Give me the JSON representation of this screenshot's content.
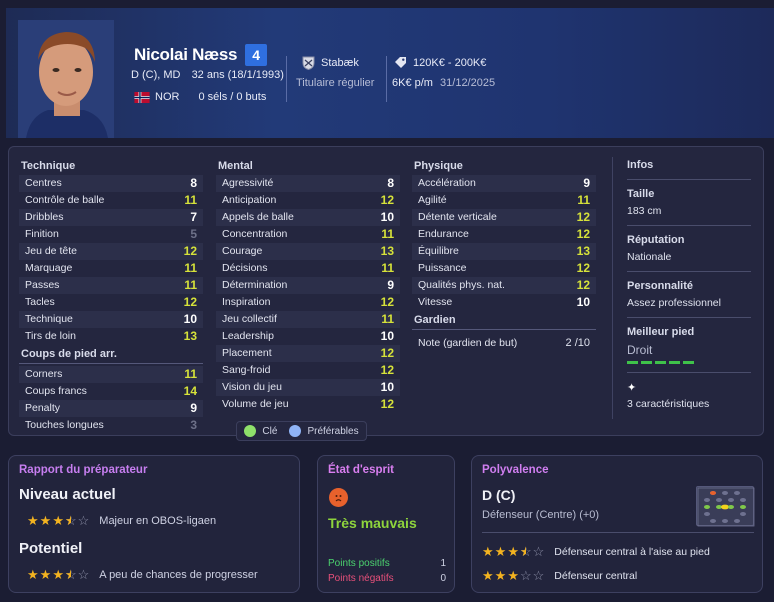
{
  "player": {
    "name": "Nicolai Næss",
    "number": "4",
    "positions": "D (C), MD",
    "age": "32 ans (18/1/1993)",
    "nationality": "NOR",
    "caps": "0 séls / 0 buts",
    "club": "Stabæk",
    "role": "Titulaire régulier",
    "value": "120K€ - 200K€",
    "wage": "6K€ p/m",
    "contract_end": "31/12/2025"
  },
  "technique": {
    "title": "Technique",
    "rows": [
      {
        "label": "Centres",
        "value": "8",
        "color": "w"
      },
      {
        "label": "Contrôle de balle",
        "value": "11",
        "color": "y"
      },
      {
        "label": "Dribbles",
        "value": "7",
        "color": "w"
      },
      {
        "label": "Finition",
        "value": "5",
        "color": "g"
      },
      {
        "label": "Jeu de tête",
        "value": "12",
        "color": "y"
      },
      {
        "label": "Marquage",
        "value": "11",
        "color": "y"
      },
      {
        "label": "Passes",
        "value": "11",
        "color": "y"
      },
      {
        "label": "Tacles",
        "value": "12",
        "color": "y"
      },
      {
        "label": "Technique",
        "value": "10",
        "color": "w"
      },
      {
        "label": "Tirs de loin",
        "value": "13",
        "color": "y"
      }
    ]
  },
  "set_pieces": {
    "title": "Coups de pied arr.",
    "rows": [
      {
        "label": "Corners",
        "value": "11",
        "color": "y"
      },
      {
        "label": "Coups francs",
        "value": "14",
        "color": "y"
      },
      {
        "label": "Penalty",
        "value": "9",
        "color": "w"
      },
      {
        "label": "Touches longues",
        "value": "3",
        "color": "g"
      }
    ]
  },
  "mental": {
    "title": "Mental",
    "rows": [
      {
        "label": "Agressivité",
        "value": "8",
        "color": "w"
      },
      {
        "label": "Anticipation",
        "value": "12",
        "color": "y"
      },
      {
        "label": "Appels de balle",
        "value": "10",
        "color": "w"
      },
      {
        "label": "Concentration",
        "value": "11",
        "color": "y"
      },
      {
        "label": "Courage",
        "value": "13",
        "color": "y"
      },
      {
        "label": "Décisions",
        "value": "11",
        "color": "y"
      },
      {
        "label": "Détermination",
        "value": "9",
        "color": "w"
      },
      {
        "label": "Inspiration",
        "value": "12",
        "color": "y"
      },
      {
        "label": "Jeu collectif",
        "value": "11",
        "color": "y"
      },
      {
        "label": "Leadership",
        "value": "10",
        "color": "w"
      },
      {
        "label": "Placement",
        "value": "12",
        "color": "y"
      },
      {
        "label": "Sang-froid",
        "value": "12",
        "color": "y"
      },
      {
        "label": "Vision du jeu",
        "value": "10",
        "color": "w"
      },
      {
        "label": "Volume de jeu",
        "value": "12",
        "color": "y"
      }
    ]
  },
  "physique": {
    "title": "Physique",
    "rows": [
      {
        "label": "Accélération",
        "value": "9",
        "color": "w"
      },
      {
        "label": "Agilité",
        "value": "11",
        "color": "y"
      },
      {
        "label": "Détente verticale",
        "value": "12",
        "color": "y"
      },
      {
        "label": "Endurance",
        "value": "12",
        "color": "y"
      },
      {
        "label": "Équilibre",
        "value": "13",
        "color": "y"
      },
      {
        "label": "Puissance",
        "value": "12",
        "color": "y"
      },
      {
        "label": "Qualités phys. nat.",
        "value": "12",
        "color": "y"
      },
      {
        "label": "Vitesse",
        "value": "10",
        "color": "w"
      }
    ]
  },
  "goalkeeper": {
    "title": "Gardien",
    "label": "Note (gardien de but)",
    "value": "2 /10"
  },
  "infos": {
    "title": "Infos",
    "height_label": "Taille",
    "height": "183 cm",
    "reputation_label": "Réputation",
    "reputation": "Nationale",
    "personality_label": "Personnalité",
    "personality": "Assez professionnel",
    "foot_label": "Meilleur pied",
    "foot": "Droit",
    "foot_level": 5,
    "traits": "3 caractéristiques"
  },
  "legend": {
    "key": "Clé",
    "preferred": "Préférables",
    "key_color": "#8ee06a",
    "preferred_color": "#8fb3f5"
  },
  "report": {
    "title": "Rapport du préparateur",
    "current_label": "Niveau actuel",
    "current_stars": 3.5,
    "current_text": "Majeur en OBOS-ligaen",
    "potential_label": "Potentiel",
    "potential_stars": 3.5,
    "potential_text": "A peu de chances de progresser"
  },
  "morale": {
    "title": "État d'esprit",
    "status": "Très mauvais",
    "positive_label": "Points positifs",
    "positive_value": "1",
    "negative_label": "Points négatifs",
    "negative_value": "0"
  },
  "versatility": {
    "title": "Polyvalence",
    "position": "D (C)",
    "position_detail": "Défenseur (Centre) (+0)",
    "roles": [
      {
        "stars": 3.5,
        "label": "Défenseur central à l'aise au pied"
      },
      {
        "stars": 3,
        "label": "Défenseur central"
      }
    ]
  },
  "colors": {
    "accent_yellow": "#d6e23a",
    "star": "#f3b320",
    "report_title": "#c77ef0",
    "morale_title": "#d97ef0",
    "versatility_title": "#d07ef0",
    "morale_status": "#8ed43c",
    "positive": "#4bd26e",
    "negative": "#e8507a"
  }
}
